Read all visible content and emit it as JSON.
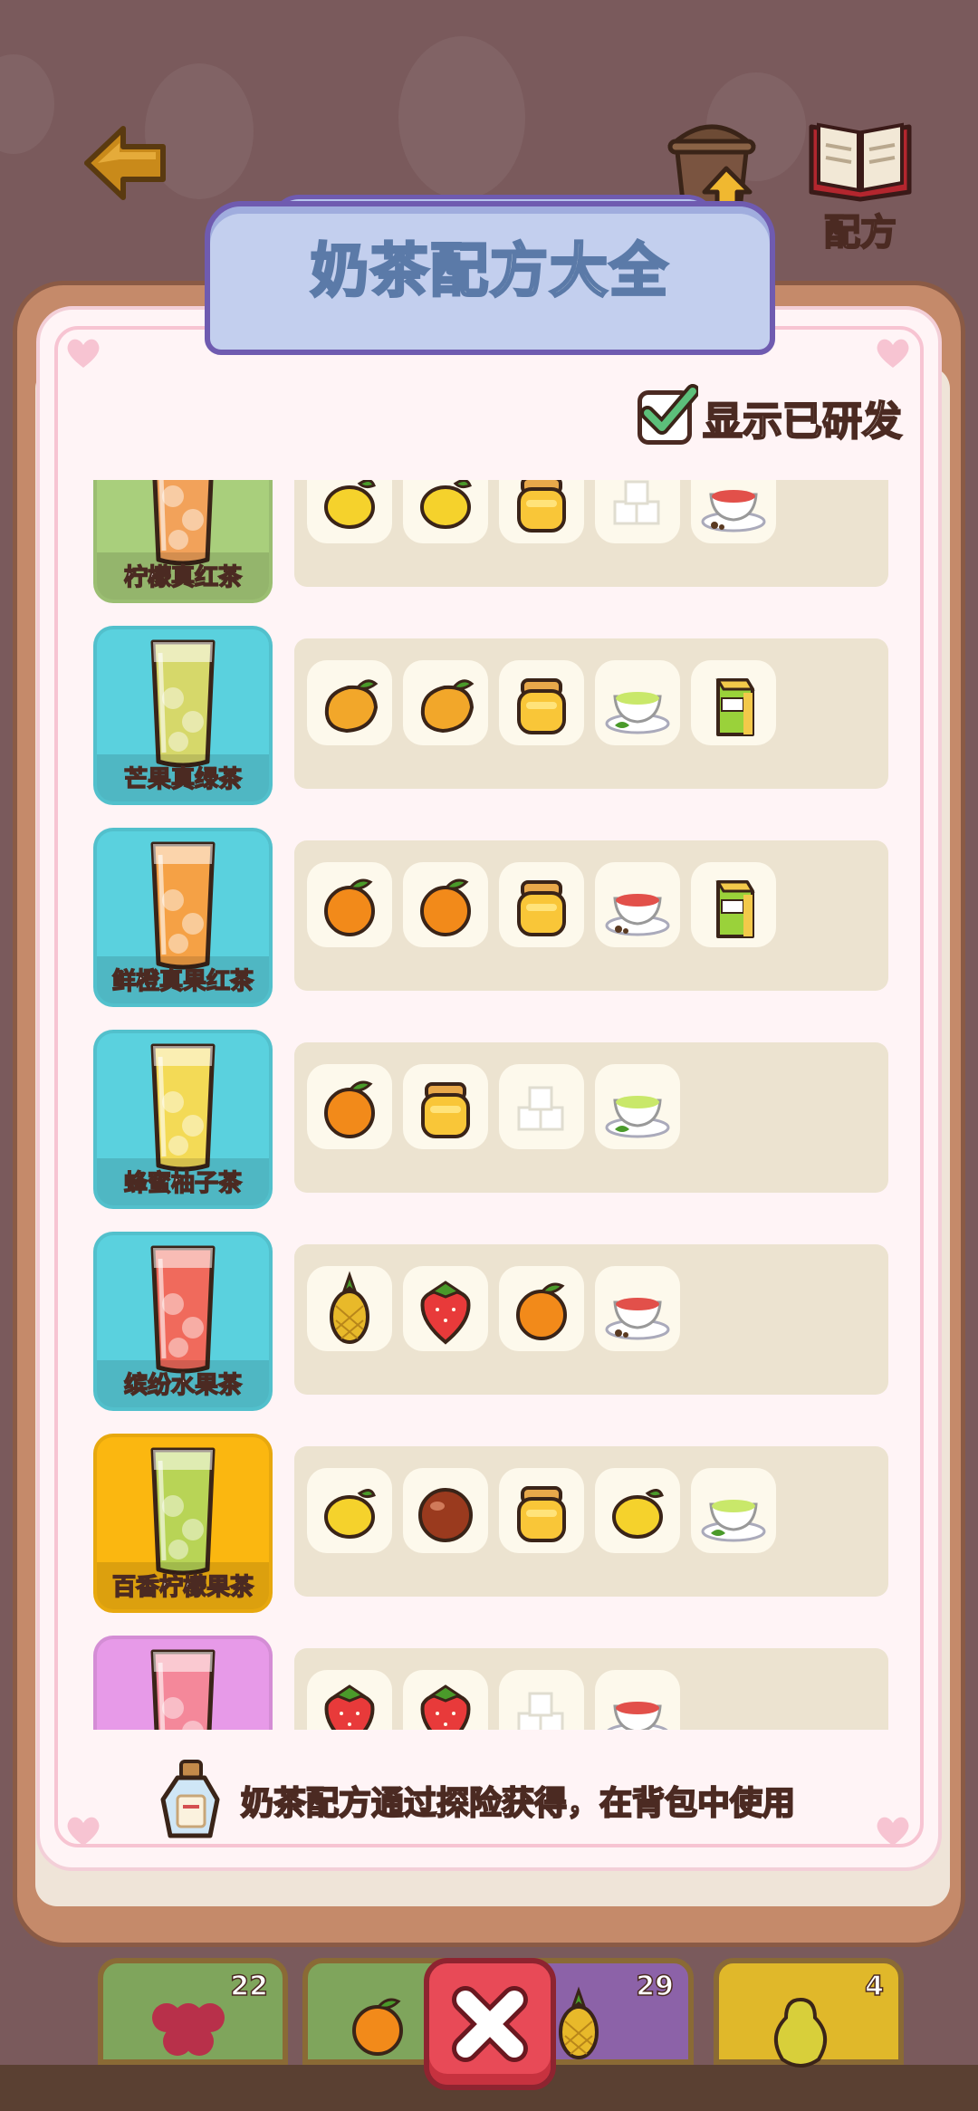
{
  "header": {
    "back_label": "",
    "upgrade_label": "",
    "recipe_label": "配方"
  },
  "panel": {
    "title": "奶茶配方大全",
    "show_developed_label": "显示已研发",
    "show_developed_checked": true,
    "tip": "奶茶配方通过探险获得，在背包中使用"
  },
  "recipes": [
    {
      "name": "柠檬真红茶",
      "card_color": "#a9cf7c",
      "drink_color": "#f2a25a",
      "ingredients": [
        "lemon-icon",
        "lemon-icon",
        "honey-jar-icon",
        "sugar-cubes-icon",
        "red-tea-icon"
      ]
    },
    {
      "name": "芒果真绿茶",
      "card_color": "#5ad1de",
      "drink_color": "#d6d86a",
      "ingredients": [
        "mango-icon",
        "mango-icon",
        "honey-jar-icon",
        "green-tea-icon",
        "milk-carton-icon"
      ]
    },
    {
      "name": "鲜橙真果红茶",
      "card_color": "#5ad1de",
      "drink_color": "#f5a145",
      "ingredients": [
        "orange-icon",
        "orange-icon",
        "honey-jar-icon",
        "red-tea-icon",
        "milk-carton-icon"
      ]
    },
    {
      "name": "蜂蜜柚子茶",
      "card_color": "#5ad1de",
      "drink_color": "#f3da56",
      "ingredients": [
        "orange-icon",
        "honey-jar-icon",
        "sugar-cubes-icon",
        "green-tea-icon"
      ]
    },
    {
      "name": "缤纷水果茶",
      "card_color": "#5ad1de",
      "drink_color": "#f06a5c",
      "ingredients": [
        "pineapple-icon",
        "strawberry-icon",
        "orange-icon",
        "red-tea-icon"
      ]
    },
    {
      "name": "百香柠檬果茶",
      "card_color": "#fbb710",
      "drink_color": "#b8d456",
      "ingredients": [
        "lemon-icon",
        "passion-fruit-icon",
        "honey-jar-icon",
        "lemon-icon",
        "green-tea-icon"
      ]
    },
    {
      "name": "",
      "card_color": "#e79ae8",
      "drink_color": "#f4889a",
      "ingredients": [
        "strawberry-icon",
        "strawberry-icon",
        "sugar-cubes-icon",
        "red-tea-icon"
      ]
    }
  ],
  "inventory": [
    {
      "icon": "grapes-icon",
      "count": "22",
      "color": "#7fa55c"
    },
    {
      "icon": "orange-icon",
      "count": "",
      "color": "#7fa55c"
    },
    {
      "icon": "pineapple-icon",
      "count": "29",
      "color": "#8c62a8"
    },
    {
      "icon": "pear-icon",
      "count": "4",
      "color": "#e0b82a"
    }
  ],
  "close_icon": "close-icon"
}
